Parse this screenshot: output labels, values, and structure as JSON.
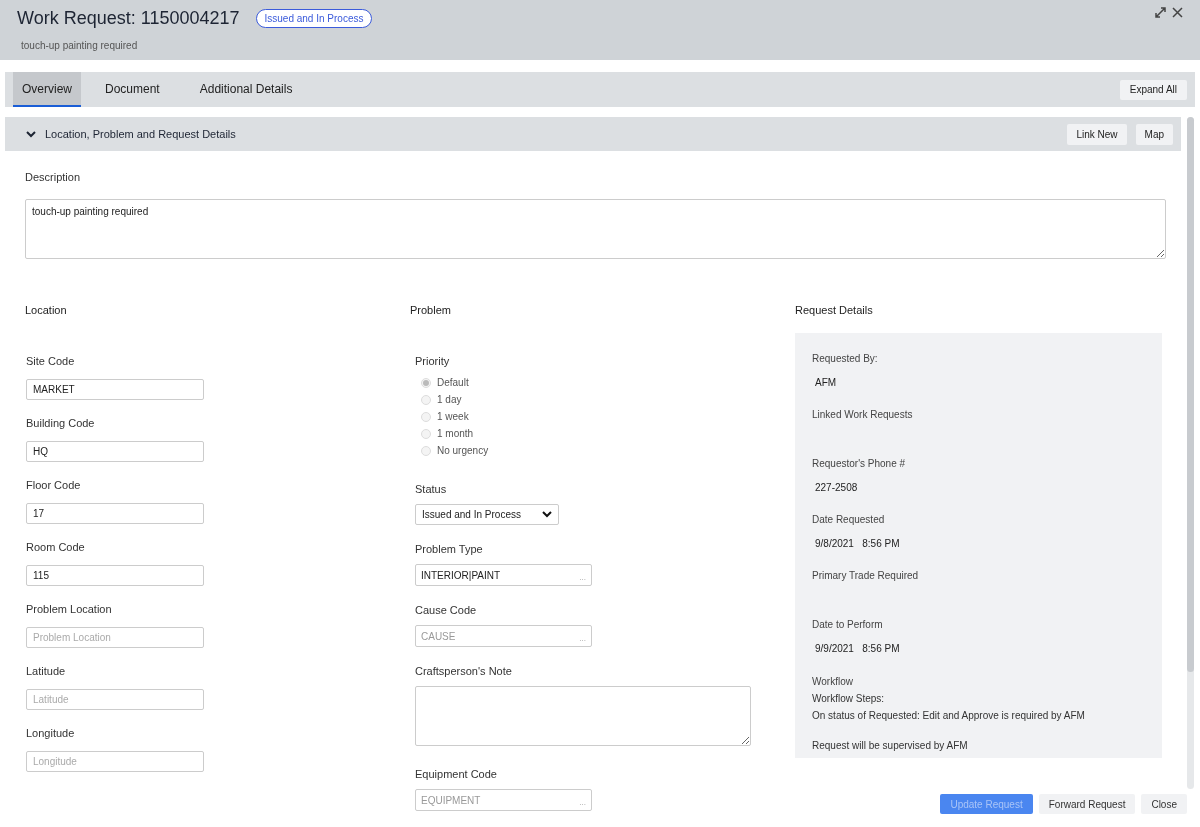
{
  "window": {
    "title": "Work Request: 1150004217",
    "status_badge": "Issued and In Process",
    "subtitle": "touch-up painting required"
  },
  "tabs": [
    {
      "label": "Overview",
      "selected": true
    },
    {
      "label": "Document",
      "selected": false
    },
    {
      "label": "Additional Details",
      "selected": false
    }
  ],
  "expand_all": "Expand All",
  "section": {
    "title": "Location, Problem and Request Details",
    "expanded": true,
    "buttons": [
      "Link New",
      "Map"
    ]
  },
  "description": {
    "label": "Description",
    "value": "touch-up painting required"
  },
  "location": {
    "heading": "Location",
    "fields": [
      {
        "label": "Site Code",
        "value": "MARKET"
      },
      {
        "label": "Building Code",
        "value": "HQ"
      },
      {
        "label": "Floor Code",
        "value": "17"
      },
      {
        "label": "Room Code",
        "value": "115"
      },
      {
        "label": "Problem Location",
        "placeholder": "Problem Location"
      },
      {
        "label": "Latitude",
        "placeholder": "Latitude"
      },
      {
        "label": "Longitude",
        "placeholder": "Longitude"
      }
    ]
  },
  "problem": {
    "heading": "Problem",
    "priority": {
      "label": "Priority",
      "disabled": true,
      "options": [
        {
          "label": "Default",
          "selected": true
        },
        {
          "label": "1 day",
          "selected": false
        },
        {
          "label": "1 week",
          "selected": false
        },
        {
          "label": "1 month",
          "selected": false
        },
        {
          "label": "No urgency",
          "selected": false
        }
      ]
    },
    "fields": [
      {
        "kind": "select",
        "label": "Status",
        "value": "Issued and In Process"
      },
      {
        "kind": "lookup",
        "label": "Problem Type",
        "value": "INTERIOR|PAINT",
        "button": "..."
      },
      {
        "kind": "lookup",
        "label": "Cause Code",
        "placeholder": "CAUSE",
        "button": "..."
      },
      {
        "kind": "textarea",
        "label": "Craftsperson's Note"
      },
      {
        "kind": "lookup",
        "label": "Equipment Code",
        "placeholder": "EQUIPMENT",
        "button": "..."
      }
    ]
  },
  "request_details": {
    "heading": "Request Details",
    "items": [
      {
        "label": "Requested By:",
        "value": "AFM"
      },
      {
        "label": "Linked Work Requests"
      },
      {
        "label": "Requestor's Phone #",
        "value": "227-2508"
      },
      {
        "label": "Date Requested",
        "value": "9/8/2021   8:56 PM"
      },
      {
        "label": "Primary Trade Required"
      },
      {
        "label": "Date to Perform",
        "value": "9/9/2021   8:56 PM"
      }
    ],
    "workflow": {
      "label": "Workflow",
      "lines": [
        "Workflow Steps:",
        "On status of Requested: Edit and Approve is required by AFM",
        "Request will be supervised by AFM"
      ]
    }
  },
  "footer": [
    {
      "label": "Update Request",
      "kind": "primary",
      "disabled": true
    },
    {
      "label": "Forward Request",
      "kind": "secondary",
      "disabled": false
    },
    {
      "label": "Close",
      "kind": "secondary",
      "disabled": false
    }
  ]
}
